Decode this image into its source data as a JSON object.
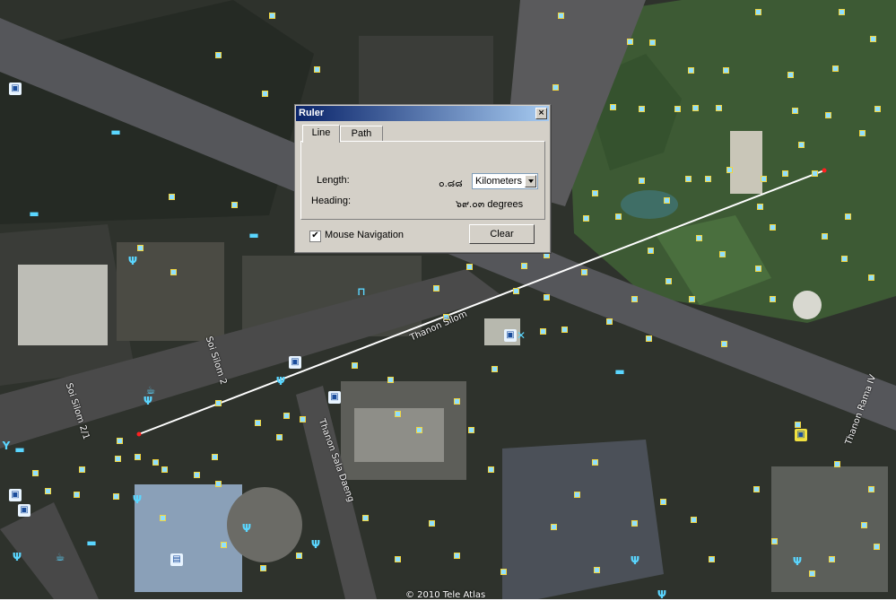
{
  "map": {
    "copyright": "© 2010 Tele Atlas",
    "road_labels": [
      "Thanon Silom",
      "Soi Silom 2",
      "Soi Silom 2/1",
      "Thanon Sala Daeng",
      "Thanon Rama IV"
    ],
    "colors": {
      "pin_fill": "#8fe0ff",
      "pin_border": "#f2d640",
      "ruler_line": "#ffffff",
      "endpoint": "#ff2020"
    }
  },
  "ruler": {
    "title": "Ruler",
    "close_glyph": "×",
    "tabs": [
      {
        "label": "Line"
      },
      {
        "label": "Path"
      }
    ],
    "length_label": "Length:",
    "length_value": "๐.๘๘",
    "unit_selected": "Kilometers",
    "heading_label": "Heading:",
    "heading_value": "๖๙.๐๓ degrees",
    "mouse_nav_label": "Mouse Navigation",
    "mouse_nav_checked": "✔",
    "clear_label": "Clear"
  }
}
